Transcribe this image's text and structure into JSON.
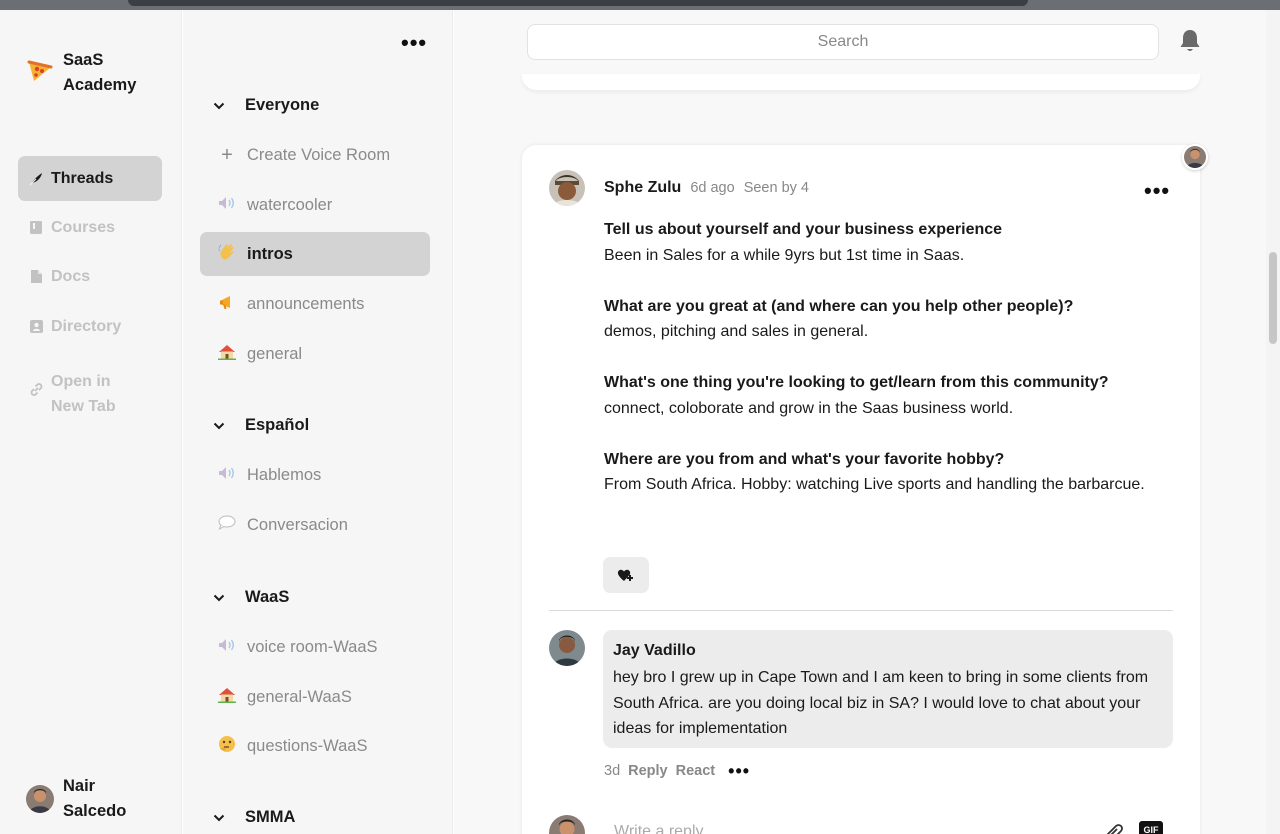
{
  "nav": {
    "brand": "SaaS Academy",
    "items": [
      {
        "label": "Threads",
        "icon": "feather-icon",
        "active": true
      },
      {
        "label": "Courses",
        "icon": "book-icon",
        "active": false
      },
      {
        "label": "Docs",
        "icon": "document-icon",
        "active": false
      },
      {
        "label": "Directory",
        "icon": "contacts-icon",
        "active": false
      },
      {
        "label": "Open in New Tab",
        "icon": "link-icon",
        "active": false
      }
    ],
    "user": "Nair Salcedo"
  },
  "channels": {
    "groups": [
      {
        "name": "Everyone",
        "items": [
          {
            "label": "Create Voice Room",
            "icon": "plus-icon"
          },
          {
            "label": "watercooler",
            "icon": "speaker-icon"
          },
          {
            "label": "intros",
            "icon": "wave-icon",
            "active": true
          },
          {
            "label": "announcements",
            "icon": "megaphone-icon"
          },
          {
            "label": "general",
            "icon": "house-icon"
          }
        ]
      },
      {
        "name": "Español",
        "items": [
          {
            "label": "Hablemos",
            "icon": "speaker-icon"
          },
          {
            "label": "Conversacion",
            "icon": "speech-bubble-icon"
          }
        ]
      },
      {
        "name": "WaaS",
        "items": [
          {
            "label": "voice room-WaaS",
            "icon": "speaker-icon"
          },
          {
            "label": "general-WaaS",
            "icon": "house-icon"
          },
          {
            "label": "questions-WaaS",
            "icon": "thinking-face-icon"
          }
        ]
      },
      {
        "name": "SMMA",
        "items": []
      }
    ]
  },
  "search": {
    "placeholder": "Search"
  },
  "post": {
    "author": "Sphe Zulu",
    "time": "6d ago",
    "seen": "Seen by 4",
    "qa": [
      {
        "q": "Tell us about yourself and your business experience",
        "a": "Been in Sales for a while 9yrs but 1st time in Saas."
      },
      {
        "q": "What are you great at (and where can you help other people)?",
        "a": "demos, pitching and sales in general."
      },
      {
        "q": "What's one thing you're looking to get/learn from this community?",
        "a": "connect, coloborate and grow in the Saas business world."
      },
      {
        "q": "Where are you from and what's your favorite hobby?",
        "a": "From South Africa. Hobby: watching Live sports and handling the barbarcue."
      }
    ]
  },
  "reply": {
    "author": "Jay Vadillo",
    "text": "hey bro I grew up in Cape Town and I am keen to bring in some clients from South Africa. are you doing local biz in SA? I would love to chat about your ideas for implementation",
    "time": "3d",
    "reply_label": "Reply",
    "react_label": "React"
  },
  "compose": {
    "placeholder": "Write a reply..."
  },
  "gif_label": "GIF",
  "colors": {
    "active_bg": "#d3d3d3",
    "muted": "#8a8a8a",
    "card": "#ffffff"
  }
}
